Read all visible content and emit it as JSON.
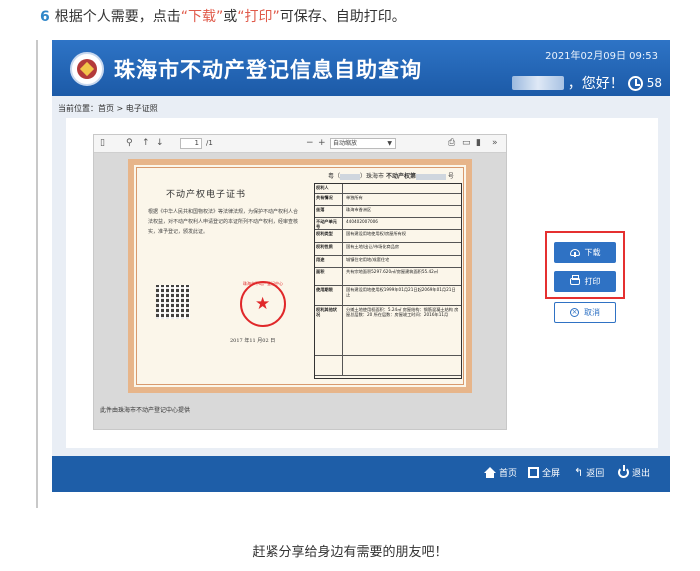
{
  "step": {
    "number": "6",
    "text_before": "根据个人需要，点击",
    "download_quote": "“下载”",
    "or": "或",
    "print_quote": "“打印”",
    "text_after": "可保存、自助打印。"
  },
  "header": {
    "title": "珠海市不动产登记信息自助查询",
    "datetime": "2021年02月09日 09:53",
    "greeting": "，您好！",
    "timer": "58"
  },
  "breadcrumb": "当前位置：首页 > 电子证照",
  "viewer": {
    "page_current": "1",
    "page_total": "/1",
    "zoom": "自动缩放",
    "toolbar": {
      "sidebar": "▯",
      "search": "⚲",
      "prev": "↑",
      "next": "↓",
      "zoom_out": "−",
      "zoom_in": "+",
      "print": "⎙",
      "open": "▭",
      "bookmark": "▮",
      "more": "»"
    }
  },
  "certificate": {
    "title": "不动产权电子证书",
    "body": "根据《中华人民共和国物权法》等法律法规，为保护不动产权利人合法权益，对不动产权利人申请登记的本证所列不动产权利，经审查核实，准予登记，颁发此证。",
    "seal_text": "珠海市不动产登记中心",
    "date": "2017 年11 月02 日",
    "number_prefix": "粤（",
    "number_city": "）珠海市",
    "number_middle": "不动产权第",
    "number_suffix": "号",
    "rows": [
      {
        "k": "权利人",
        "v": ""
      },
      {
        "k": "共有情况",
        "v": "单独所有"
      },
      {
        "k": "坐落",
        "v": "珠海市香洲区"
      },
      {
        "k": "不动产单元号",
        "v": "440402007006"
      },
      {
        "k": "权利类型",
        "v": "国有建设用地使用权/房屋所有权"
      },
      {
        "k": "权利性质",
        "v": "国有土地/出让/市场化商品房"
      },
      {
        "k": "用途",
        "v": "城镇住宅用地/成套住宅"
      },
      {
        "k": "面积",
        "v": "共有宗地面积5297.620㎡/房屋建筑面积55.42㎡"
      },
      {
        "k": "使用期限",
        "v": "国有建设用地使用权1999年01月21日起2069年01月21日止"
      },
      {
        "k": "权利其他状况",
        "v": "分摊土地使用权面积：5.24㎡ 房屋结构：钢筋混凝土结构 房屋总层数：20 所在层数：房屋竣工时间：2016年11月"
      },
      {
        "k": "",
        "v": ""
      }
    ]
  },
  "viewer_footer": "此件由珠海市不动产登记中心提供",
  "buttons": {
    "download": "下载",
    "print": "打印",
    "cancel": "取消"
  },
  "nav": {
    "home": "首页",
    "fullscreen": "全屏",
    "back": "返回",
    "exit": "退出"
  },
  "share": "赶紧分享给身边有需要的朋友吧！",
  "colors": {
    "accent_blue": "#2f72c4",
    "header_blue": "#1e5ea8",
    "highlight_red": "#e53030",
    "step_number": "#2f86c8"
  }
}
